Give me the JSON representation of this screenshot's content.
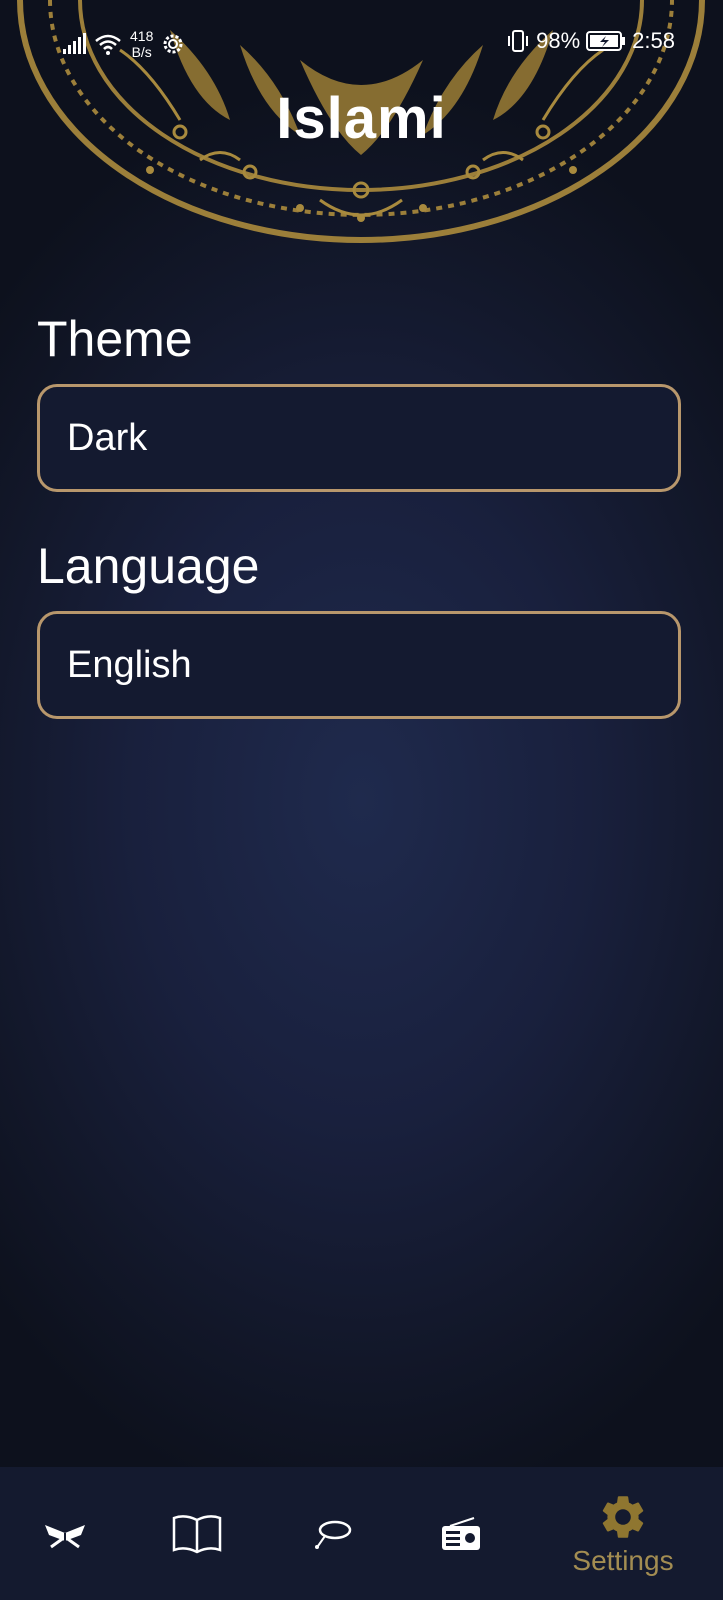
{
  "status_bar": {
    "network_speed_value": "418",
    "network_speed_unit": "B/s",
    "battery_percent": "98%",
    "time": "2:58"
  },
  "app": {
    "title": "Islami"
  },
  "settings": {
    "theme": {
      "label": "Theme",
      "value": "Dark"
    },
    "language": {
      "label": "Language",
      "value": "English"
    }
  },
  "bottom_nav": {
    "items": [
      {
        "icon": "quran-icon",
        "label": ""
      },
      {
        "icon": "book-icon",
        "label": ""
      },
      {
        "icon": "tasbeeh-icon",
        "label": ""
      },
      {
        "icon": "radio-icon",
        "label": ""
      },
      {
        "icon": "gear-icon",
        "label": "Settings",
        "active": true
      }
    ]
  },
  "colors": {
    "accent_gold": "#b8976c",
    "active_nav": "#8f7630",
    "background": "#1a2140"
  }
}
